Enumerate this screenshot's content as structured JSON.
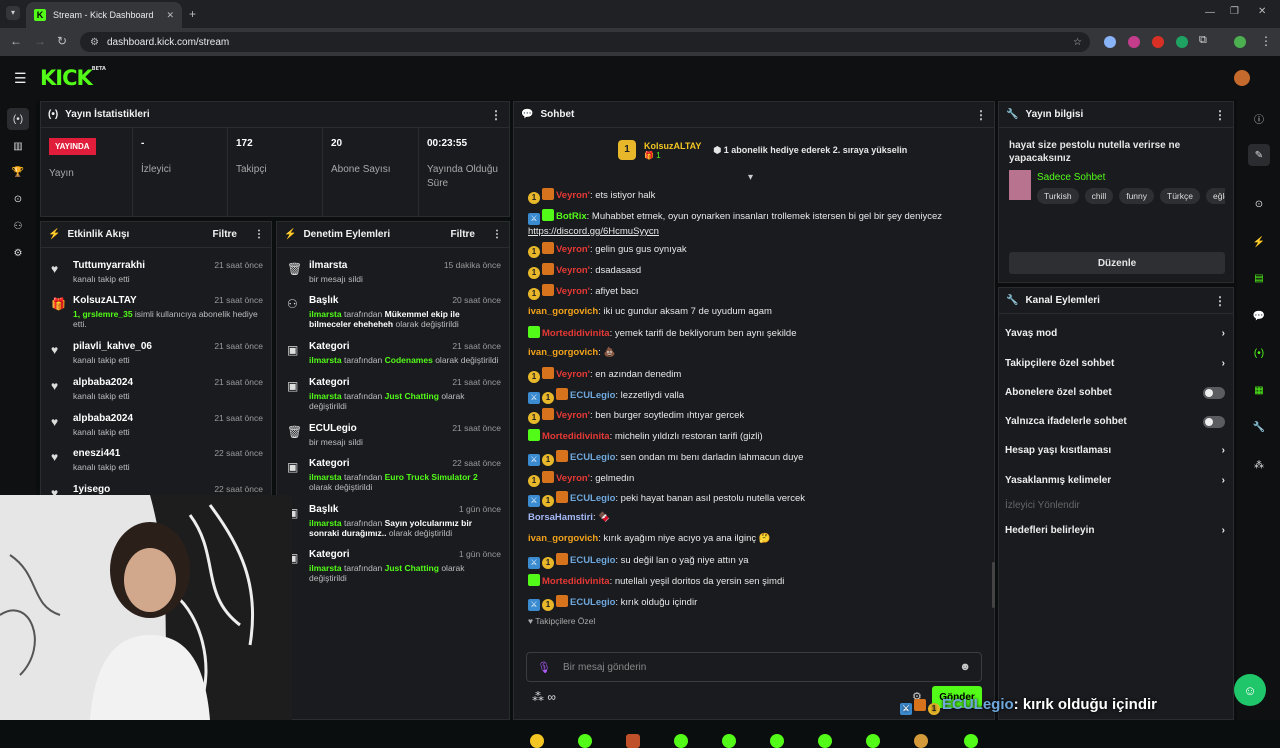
{
  "browser": {
    "tab_title": "Stream - Kick Dashboard",
    "url": "dashboard.kick.com/stream"
  },
  "app": {
    "logo": "KICK",
    "logo_badge": "BETA"
  },
  "stats": {
    "title": "Yayın İstatistikleri",
    "live_badge": "YAYINDA",
    "live_label": "Yayın",
    "viewers_value": "-",
    "viewers_label": "İzleyici",
    "followers_value": "172",
    "followers_label": "Takipçi",
    "subs_value": "20",
    "subs_label": "Abone Sayısı",
    "uptime_value": "00:23:55",
    "uptime_label": "Yayında Olduğu Süre"
  },
  "activity": {
    "title": "Etkinlik Akışı",
    "filter": "Filtre",
    "items": [
      {
        "name": "Tuttumyarrakhi",
        "time": "21 saat önce",
        "desc": "kanalı takip etti",
        "icon": "heart-icon"
      },
      {
        "name": "KolsuzALTAY",
        "time": "21 saat önce",
        "desc_green": "1, grslemre_35",
        "desc": "isimli kullanıcıya abonelik hediye etti.",
        "icon": "gift-icon"
      },
      {
        "name": "pilavli_kahve_06",
        "time": "21 saat önce",
        "desc": "kanalı takip etti",
        "icon": "heart-icon"
      },
      {
        "name": "alpbaba2024",
        "time": "21 saat önce",
        "desc": "kanalı takip etti",
        "icon": "heart-icon"
      },
      {
        "name": "alpbaba2024",
        "time": "21 saat önce",
        "desc": "kanalı takip etti",
        "icon": "heart-icon"
      },
      {
        "name": "eneszi441",
        "time": "22 saat önce",
        "desc": "kanalı takip etti",
        "icon": "heart-icon"
      },
      {
        "name": "1yisego",
        "time": "22 saat önce",
        "desc": "",
        "icon": "heart-icon"
      }
    ]
  },
  "moderation": {
    "title": "Denetim Eylemleri",
    "filter": "Filtre",
    "items": [
      {
        "name": "ilmarsta",
        "time": "15 dakika önce",
        "desc": "bir mesajı sildi",
        "icon": "trash-icon"
      },
      {
        "name": "Başlık",
        "time": "20 saat önce",
        "actor": "ilmarsta",
        "mid": "tarafından",
        "value": "Mükemmel ekip ile bilmeceler eheheheh",
        "end": "olarak değiştirildi",
        "icon": "users-icon"
      },
      {
        "name": "Kategori",
        "time": "21 saat önce",
        "actor": "ilmarsta",
        "mid": "tarafından",
        "value": "Codenames",
        "end": "olarak değiştirildi",
        "icon": "category-icon"
      },
      {
        "name": "Kategori",
        "time": "21 saat önce",
        "actor": "ilmarsta",
        "mid": "tarafından",
        "value": "Just Chatting",
        "end": "olarak değiştirildi",
        "icon": "category-icon"
      },
      {
        "name": "ECULegio",
        "time": "21 saat önce",
        "desc": "bir mesajı sildi",
        "icon": "trash-icon"
      },
      {
        "name": "Kategori",
        "time": "22 saat önce",
        "actor": "ilmarsta",
        "mid": "tarafından",
        "value": "Euro Truck Simulator 2",
        "end": "olarak değiştirildi",
        "icon": "category-icon"
      },
      {
        "name": "Başlık",
        "time": "1 gün önce",
        "actor": "ilmarsta",
        "mid": "tarafından",
        "value": "Sayın yolcularımız bir sonraki durağımız..",
        "end": "olarak değiştirildi",
        "icon": "users-icon"
      },
      {
        "name": "Kategori",
        "time": "1 gün önce",
        "actor": "ilmarsta",
        "mid": "tarafından",
        "value": "Just Chatting",
        "end": "olarak değiştirildi",
        "icon": "category-icon"
      }
    ]
  },
  "chat": {
    "title": "Sohbet",
    "pinned_user": "KolsuzALTAY",
    "pinned_count": "1",
    "pinned_text": "1 abonelik hediye ederek 2. sıraya yükselin",
    "messages": [
      {
        "user": "Veyron'",
        "color": "#e53935",
        "badges": [
          "b",
          "bs"
        ],
        "text": "ets istiyor halk"
      },
      {
        "user": "BotRix",
        "color": "#53fc18",
        "badges": [
          "bb",
          "bg"
        ],
        "text": "Muhabbet etmek, oyun oynarken insanları trollemek istersen bi gel bir şey deniycez",
        "link": "https://discord.gg/6HcmuSyycn"
      },
      {
        "user": "Veyron'",
        "color": "#e53935",
        "badges": [
          "b",
          "bs"
        ],
        "text": "gelin gus gus oynıyak"
      },
      {
        "user": "Veyron'",
        "color": "#e53935",
        "badges": [
          "b",
          "bs"
        ],
        "text": "dsadasasd"
      },
      {
        "user": "Veyron'",
        "color": "#e53935",
        "badges": [
          "b",
          "bs"
        ],
        "text": "afiyet bacı"
      },
      {
        "user": "ivan_gorgovich",
        "color": "#f3a31b",
        "badges": [],
        "text": "iki uc gundur aksam 7 de uyudum agam"
      },
      {
        "user": "Mortedidivinita",
        "color": "#e53935",
        "badges": [
          "bg"
        ],
        "text": "yemek tarifi de bekliyorum ben aynı şekilde"
      },
      {
        "user": "ivan_gorgovich",
        "color": "#f3a31b",
        "badges": [],
        "text": "💩"
      },
      {
        "user": "Veyron'",
        "color": "#e53935",
        "badges": [
          "b",
          "bs"
        ],
        "text": "en azından denedim"
      },
      {
        "user": "ECULegio",
        "color": "#6fa8dc",
        "badges": [
          "bb",
          "b",
          "bs"
        ],
        "text": "lezzetliydi valla"
      },
      {
        "user": "Veyron'",
        "color": "#e53935",
        "badges": [
          "b",
          "bs"
        ],
        "text": "ben burger soytledim ıhtıyar gercek"
      },
      {
        "user": "Mortedidivinita",
        "color": "#e53935",
        "badges": [
          "bg"
        ],
        "text": "michelin yıldızlı restoran tarifi (gizli)"
      },
      {
        "user": "ECULegio",
        "color": "#6fa8dc",
        "badges": [
          "bb",
          "b",
          "bs"
        ],
        "text": "sen ondan mı benı darladın lahmacun duye"
      },
      {
        "user": "Veyron'",
        "color": "#e53935",
        "badges": [
          "b",
          "bs"
        ],
        "text": "gelmedın"
      },
      {
        "user": "ECULegio",
        "color": "#6fa8dc",
        "badges": [
          "bb",
          "b",
          "bs"
        ],
        "text": "peki hayat banan asıl pestolu nutella vercek"
      },
      {
        "user": "BorsaHamstiri",
        "color": "#a4b8f5",
        "badges": [],
        "text": "🍫"
      },
      {
        "user": "ivan_gorgovich",
        "color": "#f3a31b",
        "badges": [],
        "text": "kırık ayağım niye acıyo ya ana ilginç 🤔"
      },
      {
        "user": "ECULegio",
        "color": "#6fa8dc",
        "badges": [
          "bb",
          "b",
          "bs"
        ],
        "text": "su değil lan o yağ niye attın ya"
      },
      {
        "user": "Mortedidivinita",
        "color": "#e53935",
        "badges": [
          "bg"
        ],
        "text": "nutellalı yeşil doritos da yersin sen şimdi"
      },
      {
        "user": "ECULegio",
        "color": "#6fa8dc",
        "badges": [
          "bb",
          "b",
          "bs"
        ],
        "text": "kırık olduğu içindir"
      }
    ],
    "followers_only": "Takipçilere Özel",
    "placeholder": "Bir mesaj gönderin",
    "send": "Gönder"
  },
  "info": {
    "title": "Yayın bilgisi",
    "stream_title": "hayat size pestolu nutella verirse ne yapacaksınız",
    "category": "Sadece Sohbet",
    "tags": [
      "Turkish",
      "chill",
      "funny",
      "Türkçe",
      "eğlence"
    ],
    "edit": "Düzenle"
  },
  "channel_actions": {
    "title": "Kanal Eylemleri",
    "items": [
      {
        "label": "Yavaş mod",
        "type": "arrow"
      },
      {
        "label": "Takipçilere özel sohbet",
        "type": "arrow"
      },
      {
        "label": "Abonelere özel sohbet",
        "type": "toggle"
      },
      {
        "label": "Yalnızca ifadelerle sohbet",
        "type": "toggle"
      },
      {
        "label": "Hesap yaşı kısıtlaması",
        "type": "arrow"
      },
      {
        "label": "Yasaklanmış kelimeler",
        "type": "arrow"
      },
      {
        "label": "İzleyici Yönlendir",
        "type": "disabled"
      },
      {
        "label": "Hedefleri belirleyin",
        "type": "arrow"
      }
    ]
  },
  "overlay": {
    "user": "ECULegio",
    "text": ": kırık olduğu içindir"
  }
}
